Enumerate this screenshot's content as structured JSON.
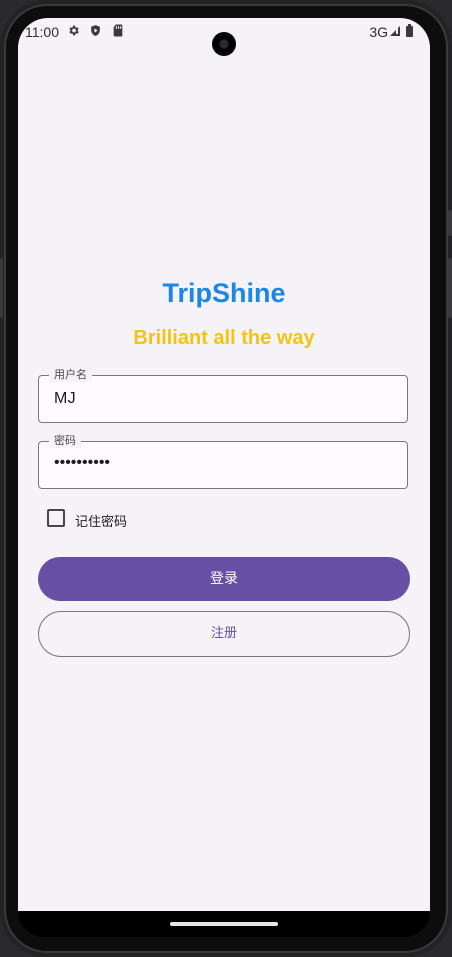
{
  "status_bar": {
    "time": "11:00",
    "icons": [
      "gear-icon",
      "shield-icon",
      "sim-card-icon"
    ],
    "network": "3G",
    "signal_icon": "signal-icon",
    "battery_icon": "battery-icon"
  },
  "app": {
    "title": "TripShine",
    "subtitle": "Brilliant all the way",
    "colors": {
      "title": "#1a86e6",
      "subtitle": "#f2c413",
      "primary": "#6750a4",
      "background": "#f5f2f8"
    }
  },
  "form": {
    "username": {
      "label": "用户名",
      "value": "MJ"
    },
    "password": {
      "label": "密码",
      "value": "••••••••••"
    },
    "remember": {
      "label": "记住密码",
      "checked": false
    },
    "login_label": "登录",
    "register_label": "注册"
  }
}
